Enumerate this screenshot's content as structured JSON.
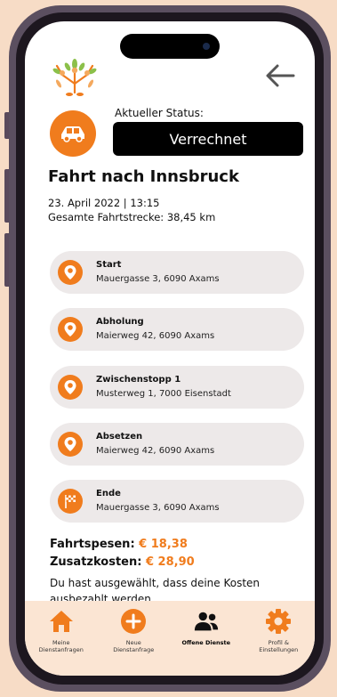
{
  "header": {
    "logo_icon": "family-tree-logo-icon",
    "back_icon": "arrow-left-icon"
  },
  "status": {
    "icon": "car-icon",
    "label": "Aktueller Status:",
    "value": "Verrechnet"
  },
  "trip": {
    "title": "Fahrt nach Innsbruck",
    "date": "23. April 2022 | 13:15",
    "distance": "Gesamte Fahrtstrecke: 38,45 km"
  },
  "stops": [
    {
      "title": "Start",
      "address": "Mauergasse 3, 6090 Axams",
      "icon": "location-pin-icon"
    },
    {
      "title": "Abholung",
      "address": "Maierweg 42, 6090 Axams",
      "icon": "location-pin-icon"
    },
    {
      "title": "Zwischenstopp 1",
      "address": "Musterweg 1, 7000 Eisenstadt",
      "icon": "location-pin-icon"
    },
    {
      "title": "Absetzen",
      "address": "Maierweg 42, 6090 Axams",
      "icon": "location-pin-icon"
    },
    {
      "title": "Ende",
      "address": "Mauergasse 3, 6090 Axams",
      "icon": "finish-flag-icon"
    }
  ],
  "costs": {
    "travel_label": "Fahrtspesen:",
    "travel_amount": "€ 18,38",
    "extra_label": "Zusatzkosten:",
    "extra_amount": "€ 28,90",
    "note": "Du hast ausgewählt, dass deine Kosten ausbezahlt werden."
  },
  "nav": [
    {
      "label": "Meine Dienstanfragen",
      "icon": "home-icon",
      "active": false
    },
    {
      "label": "Neue Dienstanfrage",
      "icon": "plus-circle-icon",
      "active": false
    },
    {
      "label": "Offene Dienste",
      "icon": "people-icon",
      "active": true
    },
    {
      "label": "Profil & Einstellungen",
      "icon": "gear-icon",
      "active": false
    }
  ],
  "colors": {
    "accent": "#f07c1d",
    "background": "#f7dcc6",
    "nav_background": "#fbe5d3",
    "status_box": "#000000",
    "stop_card": "#ede9e9"
  }
}
